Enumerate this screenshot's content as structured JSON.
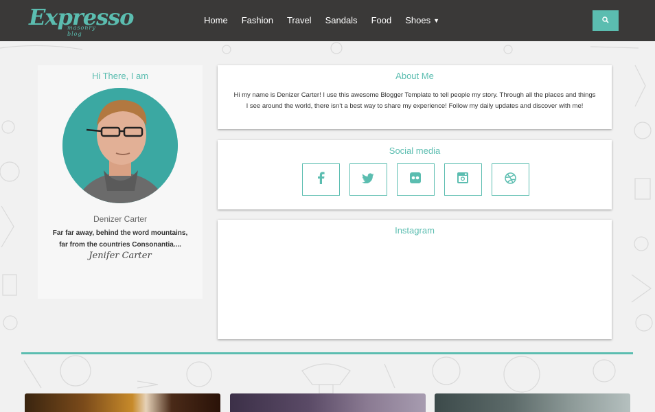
{
  "header": {
    "logo_main": "Expresso",
    "logo_sub": "masonry blog",
    "nav": [
      {
        "label": "Home",
        "dropdown": false
      },
      {
        "label": "Fashion",
        "dropdown": false
      },
      {
        "label": "Travel",
        "dropdown": false
      },
      {
        "label": "Sandals",
        "dropdown": false
      },
      {
        "label": "Food",
        "dropdown": false
      },
      {
        "label": "Shoes",
        "dropdown": true
      }
    ],
    "search_icon": "search-icon"
  },
  "profile": {
    "heading": "Hi There, I am",
    "name": "Denizer Carter",
    "bio": "Far far away, behind the word mountains, far from the countries Consonantia....",
    "signature": "Jenifer Carter"
  },
  "about": {
    "title": "About Me",
    "text": "Hi my name is Denizer Carter! I use this awesome Blogger Template to tell people my story. Through all the places and things I see around the world, there isn't a best way to share my experience! Follow my daily updates and discover with me!"
  },
  "social": {
    "title": "Social media",
    "icons": [
      "facebook-icon",
      "twitter-icon",
      "flickr-icon",
      "instagram-icon",
      "dribbble-icon"
    ]
  },
  "instagram": {
    "title": "Instagram"
  },
  "colors": {
    "accent": "#5bbdb0",
    "header_bg": "#3a3938",
    "page_bg": "#f1f1f1"
  }
}
